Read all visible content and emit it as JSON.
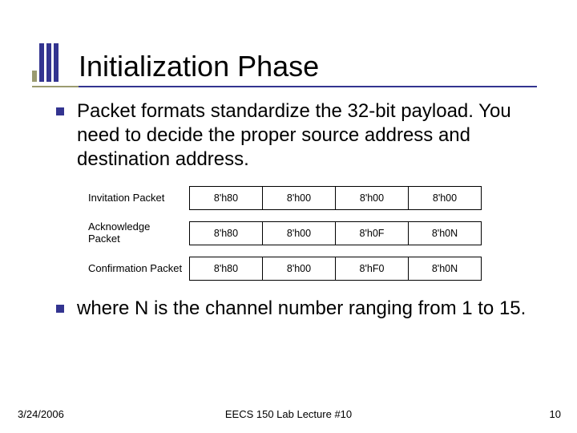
{
  "title": "Initialization Phase",
  "bullets": {
    "b1": "Packet formats standardize the 32-bit payload. You need to decide the proper source address and destination address.",
    "b2": "where N is the channel number ranging from 1 to 15."
  },
  "packet_rows": [
    {
      "label": "Invitation Packet",
      "cells": [
        "8'h80",
        "8'h00",
        "8'h00",
        "8'h00"
      ]
    },
    {
      "label": "Acknowledge Packet",
      "cells": [
        "8'h80",
        "8'h00",
        "8'h0F",
        "8'h0N"
      ]
    },
    {
      "label": "Confirmation Packet",
      "cells": [
        "8'h80",
        "8'h00",
        "8'hF0",
        "8'h0N"
      ]
    }
  ],
  "footer": {
    "date": "3/24/2006",
    "center": "EECS 150 Lab Lecture #10",
    "page": "10"
  }
}
